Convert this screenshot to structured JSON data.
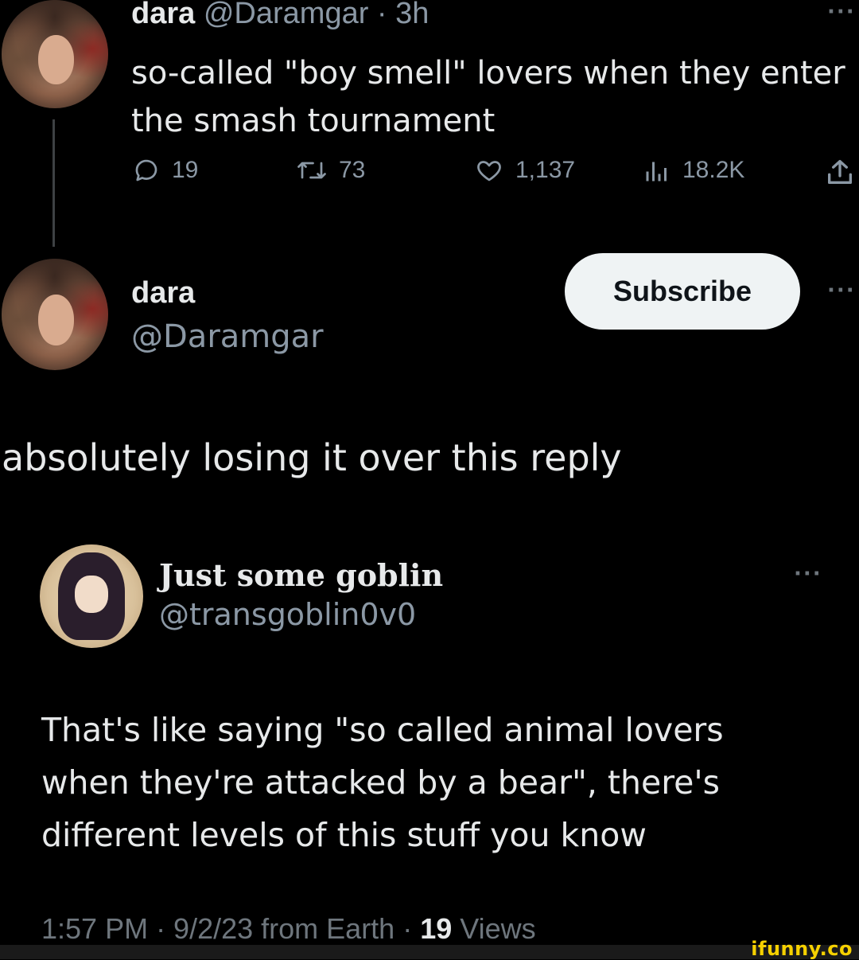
{
  "tweet1": {
    "author_name": "dara",
    "author_handle": "@Daramgar",
    "time": "· 3h",
    "text_line1": "so-called \"boy smell\" lovers when they enter",
    "text_line2": "the smash tournament",
    "stats": {
      "replies": "19",
      "retweets": "73",
      "likes": "1,137",
      "views": "18.2K"
    }
  },
  "tweet2": {
    "author_name": "dara",
    "author_handle": "@Daramgar",
    "subscribe_label": "Subscribe",
    "text": "absolutely losing it over this reply"
  },
  "quoted": {
    "author_name": "Just some goblin",
    "author_handle": "@transgoblin0v0",
    "text_line1": "That's like saying \"so called animal lovers",
    "text_line2": "when they're attacked by a bear\", there's",
    "text_line3": "different levels of this stuff you know"
  },
  "meta": {
    "timestamp": "1:57 PM · 9/2/23 from Earth · ",
    "views_count": "19",
    "views_label": " Views"
  },
  "watermark": "ifunny.co",
  "icons": [
    "reply-icon",
    "retweet-icon",
    "like-icon",
    "views-icon",
    "share-icon",
    "more-icon"
  ],
  "colors": {
    "background": "#000000",
    "text": "#e7e9ea",
    "muted": "#8b98a5",
    "button_bg": "#eff3f4",
    "watermark": "#f6d100"
  }
}
